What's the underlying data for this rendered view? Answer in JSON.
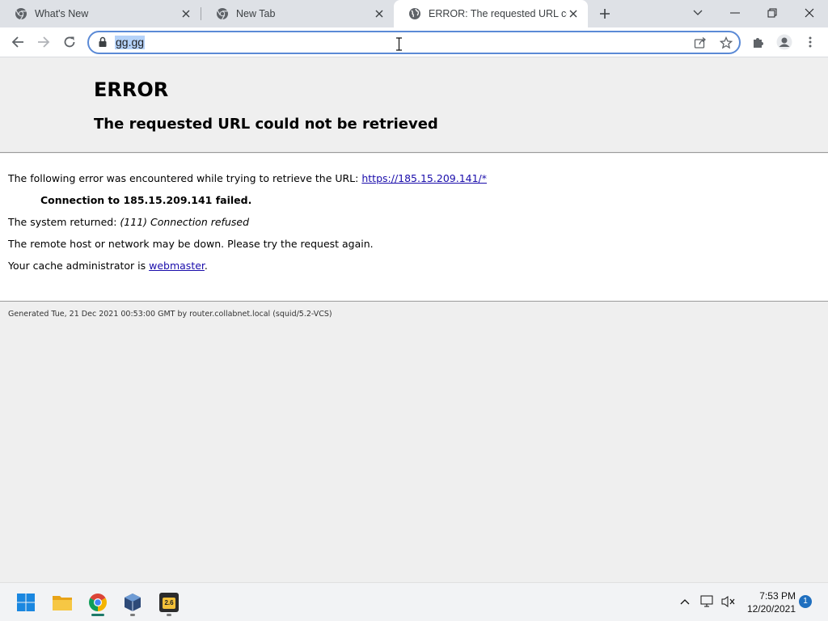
{
  "browser": {
    "tabs": [
      {
        "title": "What's New",
        "active": false
      },
      {
        "title": "New Tab",
        "active": false
      },
      {
        "title": "ERROR: The requested URL could not be retrieved",
        "active": true
      }
    ],
    "address": {
      "url": "gg.gg"
    }
  },
  "page": {
    "heading": "ERROR",
    "subheading": "The requested URL could not be retrieved",
    "line1_prefix": "The following error was encountered while trying to retrieve the URL: ",
    "line1_link": "https://185.15.209.141/*",
    "error_detail": "Connection to 185.15.209.141 failed.",
    "system_prefix": "The system returned: ",
    "system_value": "(111) Connection refused",
    "remote_msg": "The remote host or network may be down. Please try the request again.",
    "cache_prefix": "Your cache administrator is ",
    "cache_link": "webmaster",
    "cache_suffix": ".",
    "footer": "Generated Tue, 21 Dec 2021 00:53:00 GMT by router.collabnet.local (squid/5.2-VCS)"
  },
  "taskbar": {
    "apps": [
      "start",
      "file-explorer",
      "chrome",
      "virtualbox",
      "app-2.6"
    ],
    "app_badge": "2.6",
    "time": "7:53 PM",
    "date": "12/20/2021",
    "notifications": "1"
  },
  "colors": {
    "accent": "#5b8ad6",
    "link": "#1a0dab",
    "selection": "#b5d2f8"
  }
}
